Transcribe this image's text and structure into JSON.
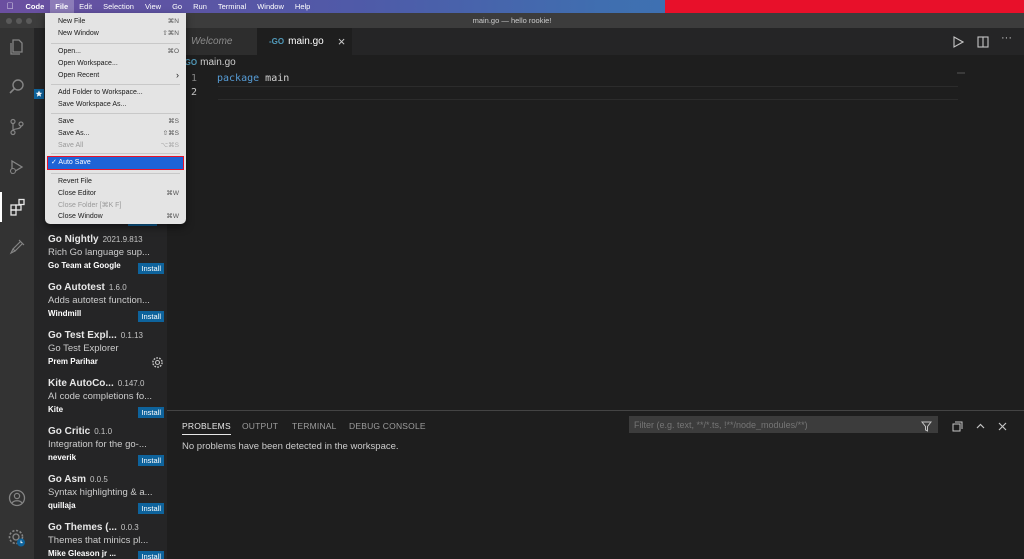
{
  "menubar": {
    "apple": "",
    "items": [
      "Code",
      "File",
      "Edit",
      "Selection",
      "View",
      "Go",
      "Run",
      "Terminal",
      "Window",
      "Help"
    ],
    "active": "File"
  },
  "window": {
    "title": "main.go — hello rookie!"
  },
  "tabs": [
    {
      "label": "Welcome",
      "italic": true
    },
    {
      "label": "main.go",
      "icon": "go-icon",
      "close": "×"
    }
  ],
  "breadcrumb": {
    "file": "main.go"
  },
  "editor": {
    "lines": [
      {
        "no": "1",
        "keyword": "package",
        "rest": " main"
      },
      {
        "no": "2",
        "keyword": "",
        "rest": ""
      }
    ]
  },
  "file_menu": {
    "groups": [
      [
        {
          "label": "New File",
          "shortcut": "⌘N"
        },
        {
          "label": "New Window",
          "shortcut": "⇧⌘N"
        }
      ],
      [
        {
          "label": "Open...",
          "shortcut": "⌘O"
        },
        {
          "label": "Open Workspace...",
          "shortcut": ""
        },
        {
          "label": "Open Recent",
          "shortcut": "›"
        }
      ],
      [
        {
          "label": "Add Folder to Workspace...",
          "shortcut": ""
        },
        {
          "label": "Save Workspace As...",
          "shortcut": ""
        }
      ],
      [
        {
          "label": "Save",
          "shortcut": "⌘S"
        },
        {
          "label": "Save As...",
          "shortcut": "⇧⌘S"
        },
        {
          "label": "Save All",
          "shortcut": "⌥⌘S",
          "disabled": true
        }
      ],
      [
        {
          "label": "✓ Auto Save",
          "shortcut": "",
          "highlighted": true
        }
      ],
      [
        {
          "label": "Revert File",
          "shortcut": ""
        },
        {
          "label": "Close Editor",
          "shortcut": "⌘W"
        },
        {
          "label": "Close Folder [⌘K F]",
          "shortcut": "",
          "disabled": true
        },
        {
          "label": "Close Window",
          "shortcut": "⌘W"
        }
      ]
    ]
  },
  "extensions": [
    {
      "name": "Go Nightly",
      "version": "2021.9.813",
      "desc": "Rich Go language sup...",
      "publisher": "Go Team at Google",
      "action": "Install"
    },
    {
      "name": "Go Autotest",
      "version": "1.6.0",
      "desc": "Adds autotest function...",
      "publisher": "Windmill",
      "action": "Install"
    },
    {
      "name": "Go Test Expl...",
      "version": "0.1.13",
      "desc": "Go Test Explorer",
      "publisher": "Prem Parihar",
      "action": "gear"
    },
    {
      "name": "Kite AutoCo...",
      "version": "0.147.0",
      "desc": "AI code completions fo...",
      "publisher": "Kite",
      "action": "Install"
    },
    {
      "name": "Go Critic",
      "version": "0.1.0",
      "desc": "Integration for the go-...",
      "publisher": "neverik",
      "action": "Install"
    },
    {
      "name": "Go Asm",
      "version": "0.0.5",
      "desc": "Syntax highlighting & a...",
      "publisher": "quillaja",
      "action": "Install"
    },
    {
      "name": "Go Themes (...",
      "version": "0.0.3",
      "desc": "Themes that minics pl...",
      "publisher": "Mike Gleason jr ...",
      "action": "Install"
    }
  ],
  "panel": {
    "tabs": [
      "PROBLEMS",
      "OUTPUT",
      "TERMINAL",
      "DEBUG CONSOLE"
    ],
    "active_tab": "PROBLEMS",
    "filter_placeholder": "Filter (e.g. text, **/*.ts, !**/node_modules/**)",
    "message": "No problems have been detected in the workspace."
  },
  "colors": {
    "accent": "#0e639c",
    "menu_highlight": "#1e63d6",
    "keyword": "#569cd6",
    "go_icon": "#519aba"
  }
}
